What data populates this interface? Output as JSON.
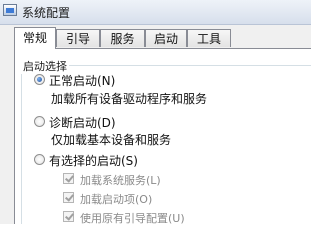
{
  "window": {
    "title": "系统配置"
  },
  "tabs": [
    {
      "label": "常规"
    },
    {
      "label": "引导"
    },
    {
      "label": "服务"
    },
    {
      "label": "启动"
    },
    {
      "label": "工具"
    }
  ],
  "startup_group": {
    "label": "启动选择",
    "options": [
      {
        "label": "正常启动(N)",
        "description": "加载所有设备驱动程序和服务",
        "selected": true
      },
      {
        "label": "诊断启动(D)",
        "description": "仅加载基本设备和服务",
        "selected": false
      },
      {
        "label": "有选择的启动(S)",
        "selected": false
      }
    ],
    "selective_items": [
      {
        "label": "加载系统服务(L)",
        "checked": true,
        "enabled": false
      },
      {
        "label": "加载启动项(O)",
        "checked": true,
        "enabled": false
      },
      {
        "label": "使用原有引导配置(U)",
        "checked": true,
        "enabled": false
      }
    ]
  }
}
